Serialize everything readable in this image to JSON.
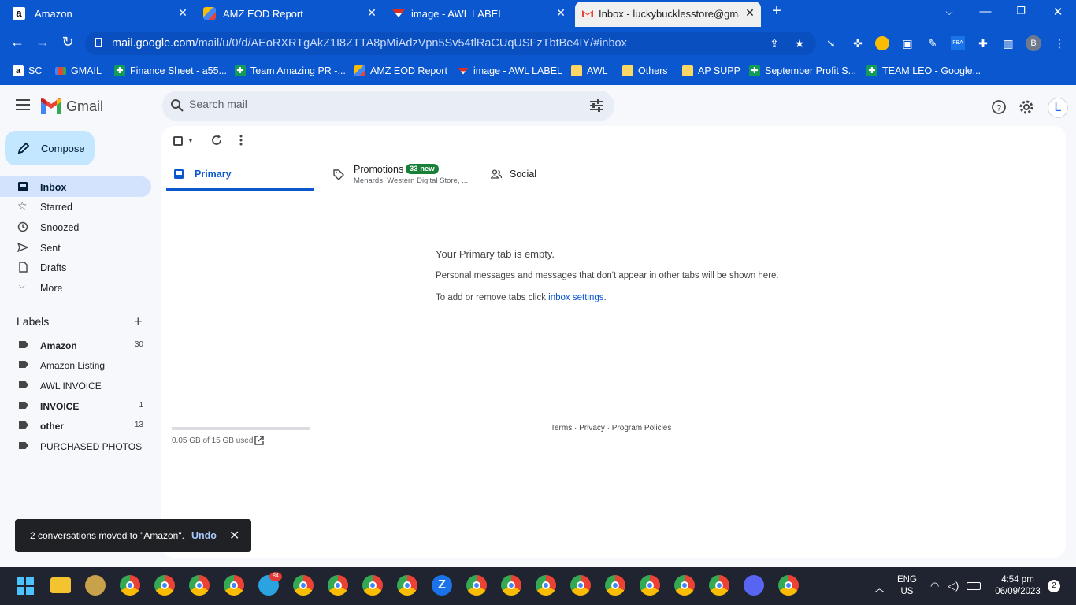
{
  "browser": {
    "tabs": [
      {
        "title": "Amazon",
        "active": false
      },
      {
        "title": "AMZ EOD Report",
        "active": false
      },
      {
        "title": "image - AWL LABEL",
        "active": false
      },
      {
        "title": "Inbox - luckybucklesstore@gmail",
        "active": true
      }
    ],
    "new_tab": "+",
    "url_host": "mail.google.com",
    "url_path": "/mail/u/0/d/AEoRXRTgAkZ1I8ZTTA8pMiAdzVpn5Sv54tlRaCUqUSFzTbtBe4IY/#inbox",
    "profile_initial": "B",
    "bookmarks": [
      "SC",
      "GMAIL",
      "Finance Sheet - a55...",
      "Team Amazing PR -...",
      "AMZ EOD Report",
      "image - AWL LABEL",
      "AWL",
      "Others",
      "AP SUPP",
      "September Profit S...",
      "TEAM LEO - Google..."
    ]
  },
  "gmail": {
    "logo_text": "Gmail",
    "search_placeholder": "Search mail",
    "avatar_initial": "L",
    "compose_label": "Compose",
    "nav": [
      {
        "label": "Inbox",
        "selected": true
      },
      {
        "label": "Starred",
        "selected": false
      },
      {
        "label": "Snoozed",
        "selected": false
      },
      {
        "label": "Sent",
        "selected": false
      },
      {
        "label": "Drafts",
        "selected": false
      },
      {
        "label": "More",
        "selected": false
      }
    ],
    "labels_title": "Labels",
    "labels_add": "+",
    "labels": [
      {
        "name": "Amazon",
        "count": "30",
        "bold": true
      },
      {
        "name": "Amazon Listing",
        "count": "",
        "bold": false
      },
      {
        "name": "AWL INVOICE",
        "count": "",
        "bold": false
      },
      {
        "name": "INVOICE",
        "count": "1",
        "bold": true
      },
      {
        "name": "other",
        "count": "13",
        "bold": true
      },
      {
        "name": "PURCHASED PHOTOS",
        "count": "",
        "bold": false
      }
    ],
    "tabs": {
      "primary": "Primary",
      "promotions": "Promotions",
      "promotions_badge": "33 new",
      "promotions_sub": "Menards, Western Digital Store, ...",
      "social": "Social"
    },
    "empty": {
      "title": "Your Primary tab is empty.",
      "desc": "Personal messages and messages that don't appear in other tabs will be shown here.",
      "tip_prefix": "To add or remove tabs click ",
      "tip_link": "inbox settings",
      "tip_suffix": "."
    },
    "storage": {
      "text": "0.05 GB of 15 GB used",
      "fraction": 0.0033
    },
    "footer": "Terms · Privacy · Program Policies",
    "snackbar": {
      "message": "2 conversations moved to \"Amazon\".",
      "undo": "Undo"
    }
  },
  "taskbar": {
    "lang": "ENG",
    "region": "US",
    "time": "4:54 pm",
    "date": "06/09/2023",
    "notifications": "2",
    "telegram_badge": "84"
  },
  "colors": {
    "accent": "#0b57d0",
    "compose": "#c2e7ff",
    "selected_nav": "#d3e3fd",
    "badge_green": "#188038"
  }
}
